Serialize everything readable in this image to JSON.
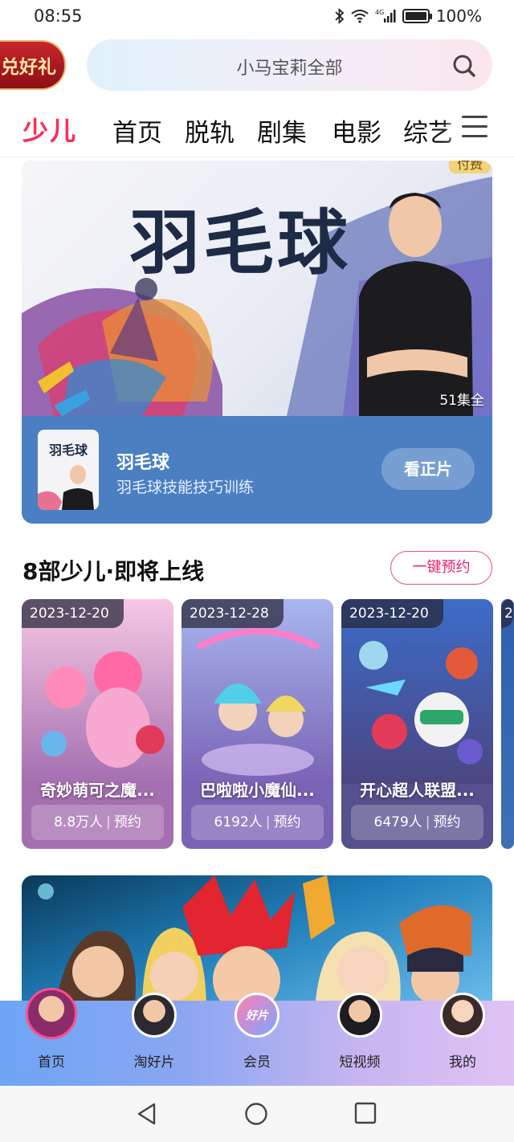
{
  "status_bar": {
    "time": "08:55",
    "battery": "100%",
    "battery_level": 1.0
  },
  "header": {
    "promo_label": "兑好礼",
    "search": {
      "placeholder": "小马宝莉全部"
    }
  },
  "channel_tabs": {
    "logo": "少儿",
    "items": [
      {
        "label": "首页"
      },
      {
        "label": "脱轨"
      },
      {
        "label": "剧集"
      },
      {
        "label": "电影"
      },
      {
        "label": "综艺"
      }
    ]
  },
  "hero": {
    "badge": "付费",
    "big_title": "羽毛球",
    "episodes": "51集全",
    "thumb_title": "羽毛球",
    "name": "羽毛球",
    "desc": "羽毛球技能技巧训练",
    "watch_label": "看正片"
  },
  "upcoming": {
    "title": "8部少儿·即将上线",
    "reserve_all_label": "一键预约",
    "cards": [
      {
        "date": "2023-12-20",
        "title": "奇妙萌可之魔...",
        "count": "8.8万人",
        "action": "预约",
        "color": "#a46fb0"
      },
      {
        "date": "2023-12-28",
        "title": "巴啦啦小魔仙...",
        "count": "6192人",
        "action": "预约",
        "color": "#7a63b5"
      },
      {
        "date": "2023-12-20",
        "title": "开心超人联盟...",
        "count": "6479人",
        "action": "预约",
        "color": "#55508e"
      },
      {
        "date": "2",
        "title": "",
        "count": "",
        "action": "",
        "color": "#3f6fb4"
      }
    ]
  },
  "bottom_nav": {
    "items": [
      {
        "label": "首页",
        "active": true
      },
      {
        "label": "淘好片"
      },
      {
        "label": "会员",
        "badge_text": "好片"
      },
      {
        "label": "短视频"
      },
      {
        "label": "我的"
      }
    ]
  },
  "icons": [
    "bluetooth-icon",
    "wifi-icon",
    "signal-icon",
    "battery-icon",
    "search-icon",
    "menu-icon",
    "back-icon",
    "home-icon",
    "recents-icon"
  ]
}
